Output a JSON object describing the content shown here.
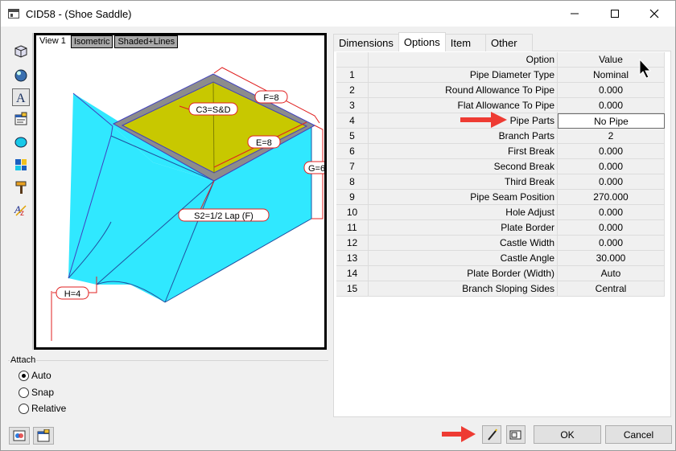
{
  "window": {
    "title": "CID58 - (Shoe Saddle)"
  },
  "view_tabs": [
    "View 1",
    "Isometric",
    "Shaded+Lines"
  ],
  "drawing_labels": {
    "c3": "C3=S&D",
    "f": "F=8",
    "e": "E=8",
    "g": "G=6",
    "s2": "S2=1/2 Lap (F)",
    "h": "H=4"
  },
  "attach": {
    "legend": "Attach",
    "options": [
      "Auto",
      "Snap",
      "Relative"
    ],
    "selected": "Auto"
  },
  "tabs": [
    "Dimensions",
    "Options",
    "Item",
    "Other"
  ],
  "active_tab": "Options",
  "grid": {
    "headers": [
      "Option",
      "Value"
    ],
    "rows": [
      {
        "num": "1",
        "option": "Pipe Diameter Type",
        "value": "Nominal"
      },
      {
        "num": "2",
        "option": "Round Allowance To Pipe",
        "value": "0.000"
      },
      {
        "num": "3",
        "option": "Flat Allowance To Pipe",
        "value": "0.000"
      },
      {
        "num": "4",
        "option": "Pipe Parts",
        "value": "No Pipe"
      },
      {
        "num": "5",
        "option": "Branch Parts",
        "value": "2"
      },
      {
        "num": "6",
        "option": "First Break",
        "value": "0.000"
      },
      {
        "num": "7",
        "option": "Second Break",
        "value": "0.000"
      },
      {
        "num": "8",
        "option": "Third Break",
        "value": "0.000"
      },
      {
        "num": "9",
        "option": "Pipe Seam Position",
        "value": "270.000"
      },
      {
        "num": "10",
        "option": "Hole Adjust",
        "value": "0.000"
      },
      {
        "num": "11",
        "option": "Plate Border",
        "value": "0.000"
      },
      {
        "num": "12",
        "option": "Castle Width",
        "value": "0.000"
      },
      {
        "num": "13",
        "option": "Castle Angle",
        "value": "30.000"
      },
      {
        "num": "14",
        "option": "Plate Border (Width)",
        "value": "Auto"
      },
      {
        "num": "15",
        "option": "Branch Sloping Sides",
        "value": "Central"
      }
    ]
  },
  "buttons": {
    "ok": "OK",
    "cancel": "Cancel"
  },
  "colors": {
    "top_face": "#c8c800",
    "side_face": "#30e8ff",
    "edge": "#4040c0",
    "dimension": "#e02020",
    "arrow": "#ee3b33"
  }
}
